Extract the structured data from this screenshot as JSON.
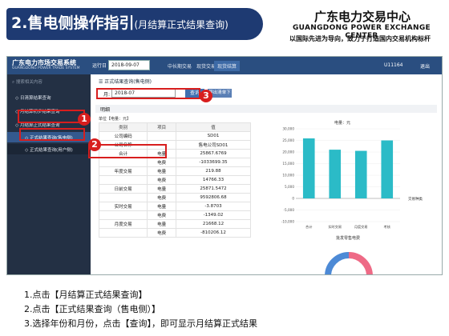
{
  "header": {
    "title": "2.售电侧操作指引",
    "subtitle": "(月结算正式结果查询)",
    "org_name": "广东电力交易中心",
    "org_en": "GUANGDONG POWER EXCHANGE CENTER",
    "slogan": "以国际先进为导向，致力于打造国内交易机构标杆"
  },
  "app": {
    "system_name": "广东电力市场交易系统",
    "system_name_en": "GUANGDONG POWER TRADE SYSTEM",
    "period_label": "运行日",
    "period_value": "2018-09-07",
    "nav": [
      "中长期交易",
      "现货交易",
      "现货结算"
    ],
    "user": "U11164",
    "exit": "退出"
  },
  "sidebar": {
    "search_placeholder": "搜索相关内容",
    "items": [
      {
        "label": "日清算结果查询"
      },
      {
        "label": "月结算初步结果查询"
      },
      {
        "label": "月结算正式结果查询"
      },
      {
        "label": "正式结果查询(售电侧)"
      },
      {
        "label": "正式结果查询(用户侧)"
      }
    ]
  },
  "main": {
    "form_title": "正式结果查询(售电侧)",
    "date_label": "月:",
    "date_value": "2018-07",
    "query_label": "查询",
    "export_label": "导出清单下载",
    "detail_label": "明细",
    "unit_note": "单位【电量：元】",
    "table": {
      "headers": [
        "类别",
        "项目",
        "值"
      ],
      "rows": [
        [
          "公司编码",
          "",
          "SD01"
        ],
        [
          "公司名称",
          "",
          "售电公司SD01"
        ],
        [
          "合计",
          "电量",
          "25867.6769"
        ],
        [
          "",
          "电费",
          "-1033699.35"
        ],
        [
          "年度交易",
          "电量",
          "219.88"
        ],
        [
          "",
          "电费",
          "14766.33"
        ],
        [
          "日前交易",
          "电量",
          "25871.5472"
        ],
        [
          "",
          "电费",
          "9592806.68"
        ],
        [
          "实时交易",
          "电量",
          "-3.8703"
        ],
        [
          "",
          "电费",
          "-1349.02"
        ],
        [
          "月度交易",
          "电量",
          "21668.12"
        ],
        [
          "",
          "电费",
          "-810206.12"
        ]
      ]
    }
  },
  "chart_data": {
    "type": "bar",
    "title": "电量：元",
    "categories": [
      "合计",
      "实时交易",
      "月度交易",
      "考核"
    ],
    "values": [
      25867.68,
      21000,
      20500,
      25000
    ],
    "ylim": [
      -10000,
      30000
    ],
    "yticks": [
      "30,000",
      "25,000",
      "20,000",
      "15,000",
      "10,000",
      "5,000",
      "0",
      "-5,000",
      "-10,000"
    ],
    "legend": "交易种类",
    "second_title": "批发零售电费",
    "color": "#2bbbc7"
  },
  "annotations": [
    "1",
    "2",
    "3"
  ],
  "steps": [
    "1.点击【月结算正式结果查询】",
    "2.点击【正式结果查询（售电侧）】",
    "3.选择年份和月份，点击【查询】，即可显示月结算正式结果"
  ]
}
